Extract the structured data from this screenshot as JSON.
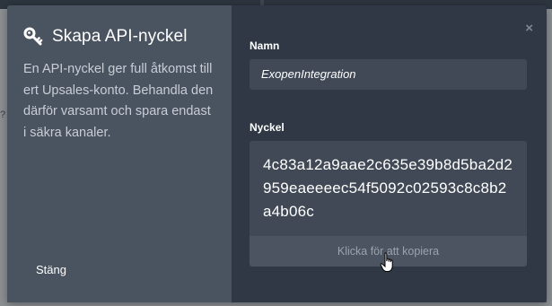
{
  "modal": {
    "title": "Skapa API-nyckel",
    "description": "En API-nyckel ger full åtkomst till ert Upsales-konto. Behandla den därför varsamt och spara endast i säkra kanaler.",
    "close_text": "Stäng",
    "close_icon": "×"
  },
  "form": {
    "name_label": "Namn",
    "name_value": "ExopenIntegration",
    "key_label": "Nyckel",
    "key_value": "4c83a12a9aae2c635e39b8d5ba2d2959eaeeeec54f5092c02593c8c8b2a4b06c",
    "copy_label": "Klicka för att kopiera"
  },
  "colors": {
    "left_pane": "#4a5360",
    "right_pane": "#2f3844",
    "input_bg": "#404955"
  }
}
